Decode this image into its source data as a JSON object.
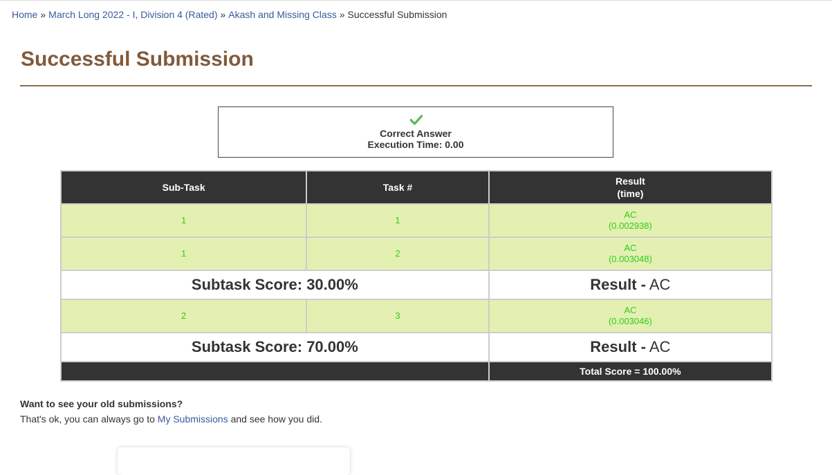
{
  "breadcrumb": {
    "items": [
      "Home",
      "March Long 2022 - I, Division 4 (Rated)",
      "Akash and Missing Class"
    ],
    "current": "Successful Submission",
    "separator": "»"
  },
  "page_title": "Successful Submission",
  "verdict": {
    "icon": "check-icon",
    "status": "Correct Answer",
    "execution_time": "Execution Time: 0.00"
  },
  "table": {
    "headers": {
      "subtask": "Sub-Task",
      "task": "Task #",
      "result_line1": "Result",
      "result_line2": "(time)"
    },
    "group1": {
      "rows": [
        {
          "subtask": "1",
          "task": "1",
          "status": "AC",
          "time": "(0.002938)"
        },
        {
          "subtask": "1",
          "task": "2",
          "status": "AC",
          "time": "(0.003048)"
        }
      ],
      "score": "Subtask Score: 30.00%",
      "result_label": "Result -",
      "result_value": " AC"
    },
    "group2": {
      "rows": [
        {
          "subtask": "2",
          "task": "3",
          "status": "AC",
          "time": "(0.003046)"
        }
      ],
      "score": "Subtask Score: 70.00%",
      "result_label": "Result -",
      "result_value": " AC"
    },
    "total": "Total Score = 100.00%"
  },
  "old_submissions": {
    "question": "Want to see your old submissions?",
    "text_before": "That's ok, you can always go to ",
    "link": "My Submissions",
    "text_after": " and see how you did."
  },
  "colors": {
    "title": "#7f5a3c",
    "link": "#3a5a9b",
    "accepted_row_bg": "#e4f0b1",
    "accepted_text": "#2ecc1f",
    "header_bg": "#333333"
  }
}
